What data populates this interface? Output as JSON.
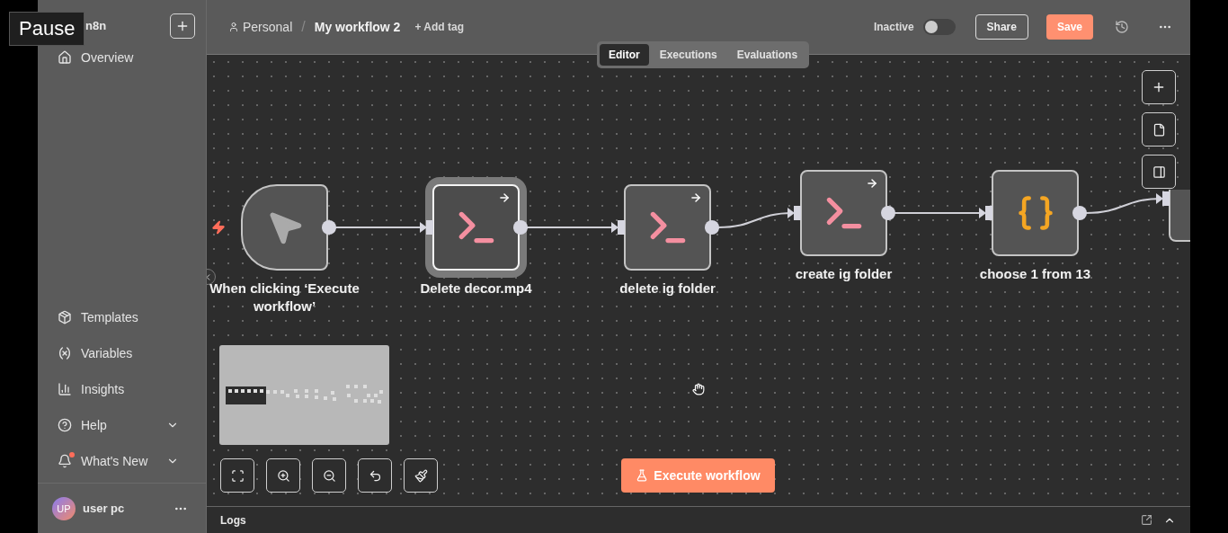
{
  "player_overlay": {
    "label": "Pause"
  },
  "sidebar": {
    "brand": "n8n",
    "top_items": [
      {
        "label": "Overview"
      }
    ],
    "bottom_items": [
      {
        "label": "Templates",
        "kind": "link"
      },
      {
        "label": "Variables",
        "kind": "link"
      },
      {
        "label": "Insights",
        "kind": "link"
      },
      {
        "label": "Help",
        "kind": "menu"
      },
      {
        "label": "What's New",
        "kind": "menu",
        "badge": true
      }
    ],
    "user": {
      "initials": "UP",
      "name": "user pc"
    }
  },
  "header": {
    "project": "Personal",
    "separator": "/",
    "title": "My workflow 2",
    "add_tag": "+ Add tag",
    "status": "Inactive",
    "toggle": {
      "on": false
    },
    "share": "Share",
    "save": "Save"
  },
  "tabs": [
    {
      "label": "Editor",
      "selected": true
    },
    {
      "label": "Executions",
      "selected": false
    },
    {
      "label": "Evaluations",
      "selected": false
    }
  ],
  "nodes": [
    {
      "kind": "trigger",
      "label": "When clicking ‘Execute workflow’",
      "selected": false
    },
    {
      "kind": "code",
      "label": "Delete decor.mp4",
      "selected": true
    },
    {
      "kind": "code",
      "label": "delete ig folder",
      "selected": false
    },
    {
      "kind": "code",
      "label": "create ig folder",
      "selected": false
    },
    {
      "kind": "set",
      "label": "choose 1 from 13",
      "selected": false
    },
    {
      "kind": "blank",
      "selected": false
    }
  ],
  "execute_button": "Execute workflow",
  "logs": {
    "title": "Logs"
  }
}
